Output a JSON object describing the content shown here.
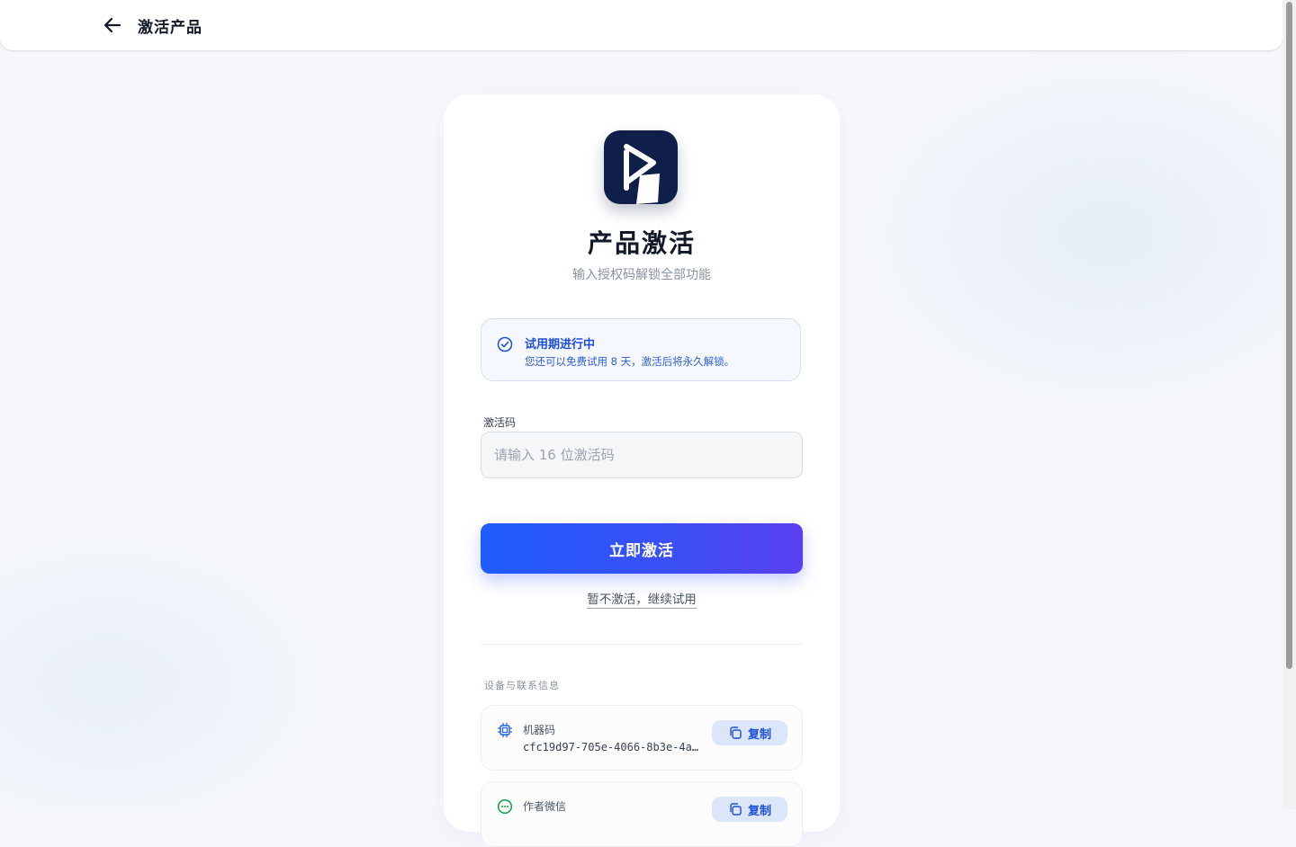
{
  "header": {
    "title": "激活产品"
  },
  "card": {
    "title": "产品激活",
    "subtitle": "输入授权码解锁全部功能",
    "trial": {
      "title": "试用期进行中",
      "description": "您还可以免费试用 8 天，激活后将永久解锁。"
    },
    "activation_field": {
      "label": "激活码",
      "value": "",
      "placeholder": "请输入 16 位激活码"
    },
    "activate_label": "立即激活",
    "skip_label": "暂不激活，继续试用",
    "info_section": {
      "label": "设备与联系信息",
      "rows": [
        {
          "label": "机器码",
          "value": "cfc19d97-705e-4066-8b3e-4a…",
          "copy_label": "复制",
          "icon": "chip-icon"
        },
        {
          "label": "作者微信",
          "value": "",
          "copy_label": "复制",
          "icon": "chat-icon"
        }
      ]
    }
  },
  "colors": {
    "accent": "#1f5cff",
    "accent_end": "#5b3ff0",
    "trial_text": "#1d4ed8",
    "logo_bg": "#0f1f4a",
    "wechat_green": "#16a34a"
  }
}
